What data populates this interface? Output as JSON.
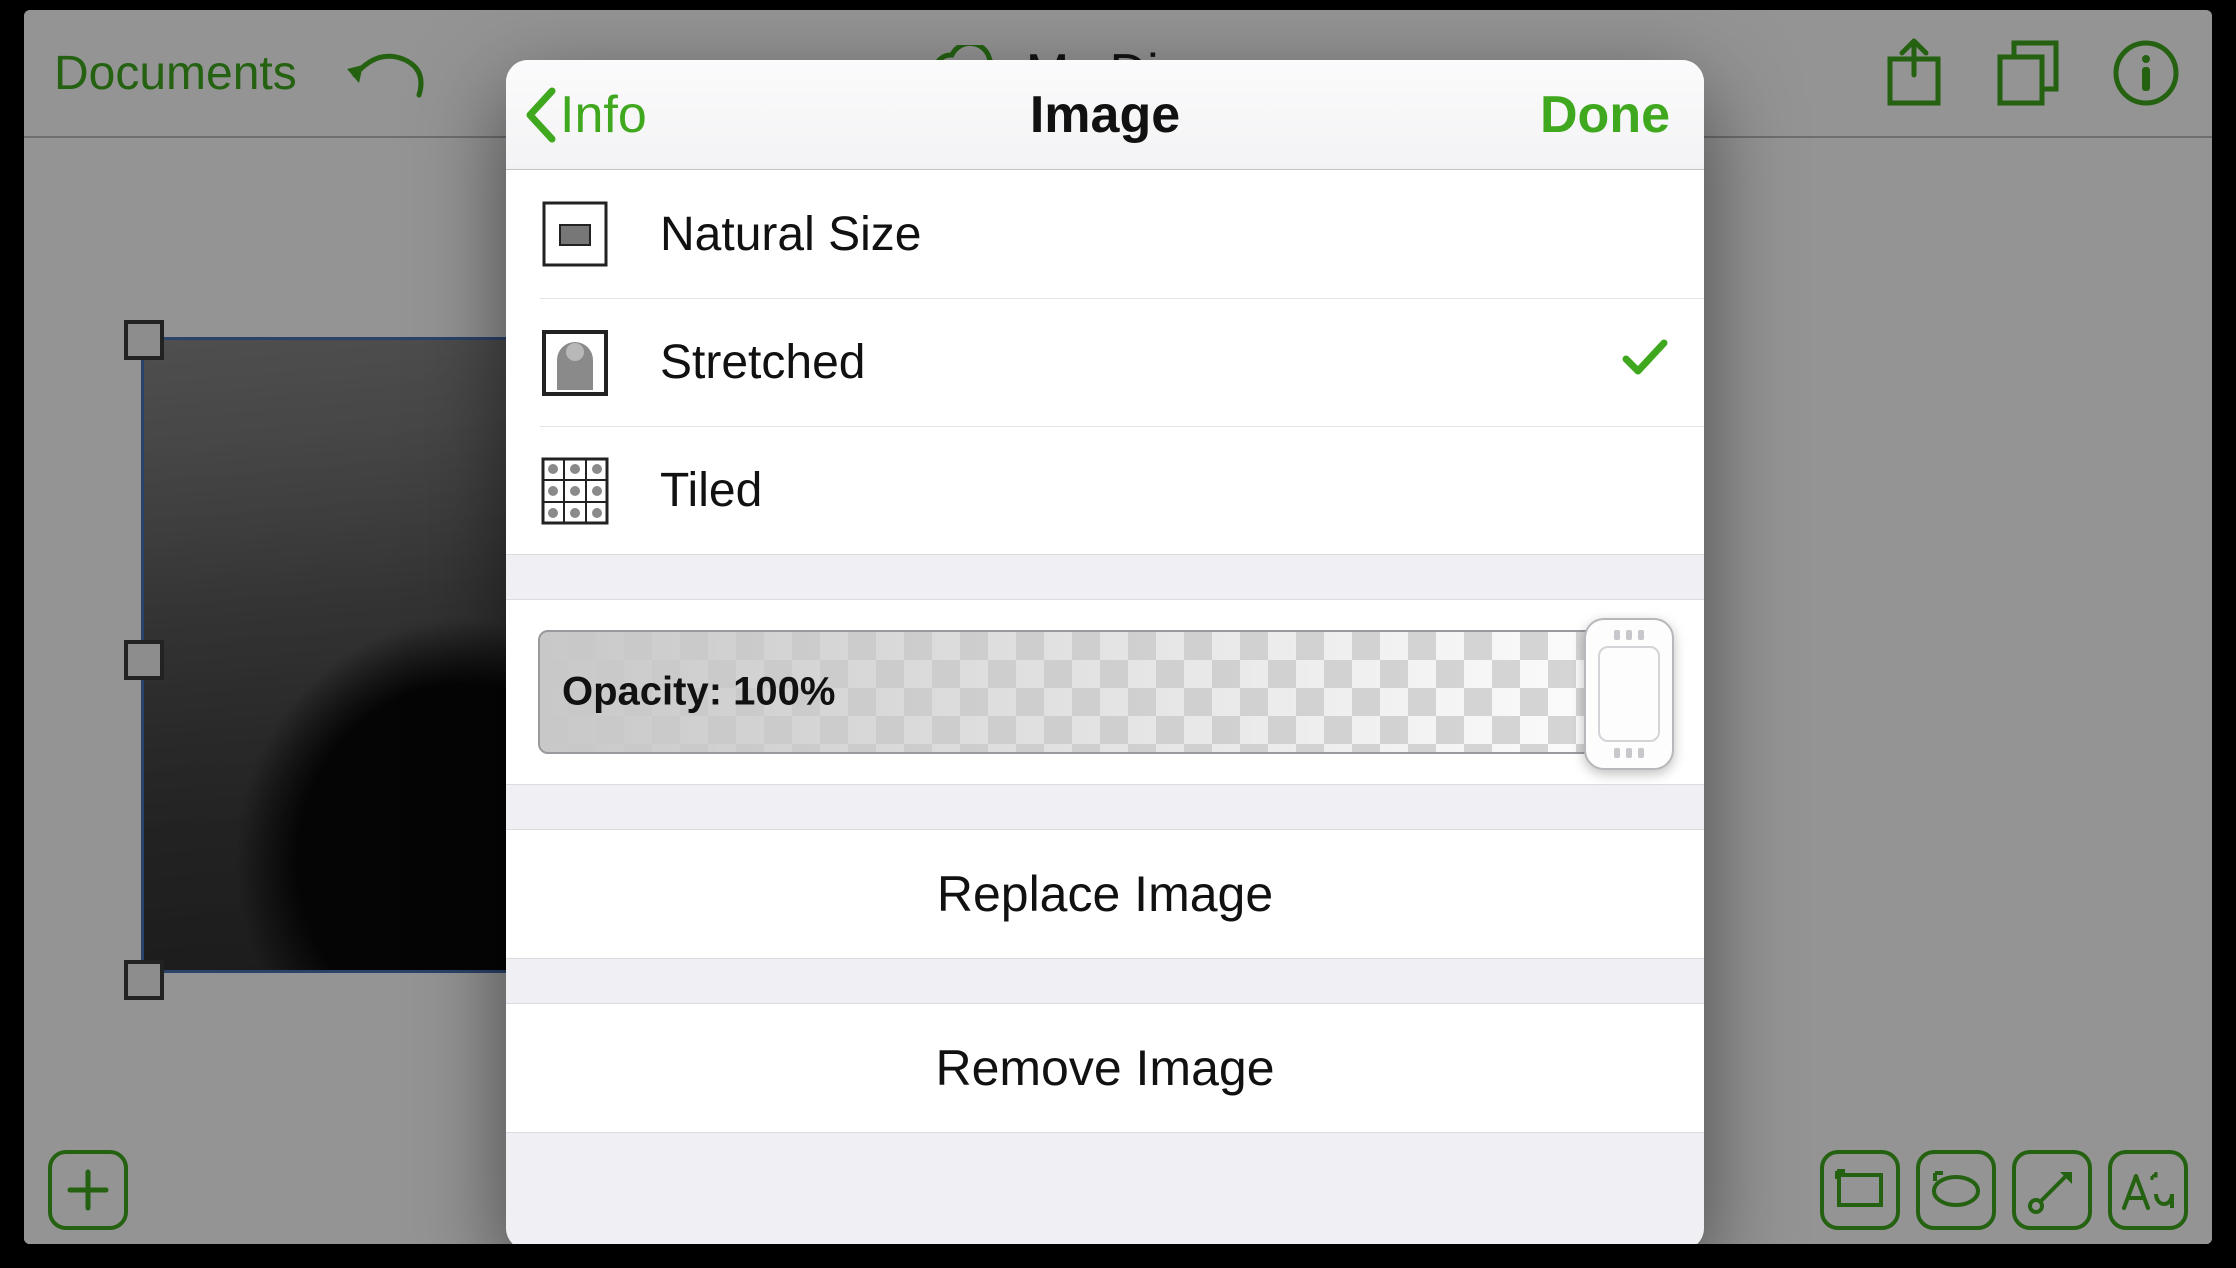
{
  "colors": {
    "accent": "#3fa81e"
  },
  "toolbar": {
    "documents_label": "Documents",
    "document_title": "My Diagram"
  },
  "modal": {
    "back_label": "Info",
    "title": "Image",
    "done_label": "Done",
    "size_options": [
      {
        "label": "Natural Size",
        "selected": false
      },
      {
        "label": "Stretched",
        "selected": true
      },
      {
        "label": "Tiled",
        "selected": false
      }
    ],
    "opacity_label": "Opacity: 100%",
    "replace_label": "Replace Image",
    "remove_label": "Remove Image"
  }
}
